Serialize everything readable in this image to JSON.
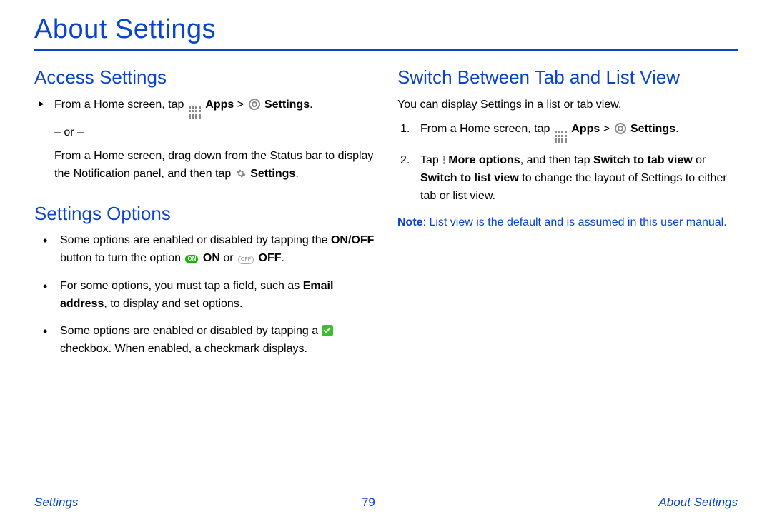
{
  "title": "About Settings",
  "footer": {
    "left": "Settings",
    "page": "79",
    "right": "About Settings"
  },
  "left": {
    "access_heading": "Access Settings",
    "access": {
      "line1_a": "From a Home screen, tap ",
      "apps_bold": "Apps",
      "gt": " > ",
      "settings_bold": "Settings",
      "period": ".",
      "or": "– or –",
      "line2_a": "From a Home screen, drag down from the Status bar to display the Notification panel, and then tap ",
      "line2_settings_bold": "Settings",
      "line2_end": "."
    },
    "options_heading": "Settings Options",
    "options": {
      "b1_a": "Some options are enabled or disabled by tapping the ",
      "b1_onoff": "ON/OFF",
      "b1_b": " button to turn the option ",
      "b1_on_label": "ON",
      "b1_on_bold": "ON",
      "b1_or": " or ",
      "b1_off_label": "OFF",
      "b1_off_bold": "OFF",
      "b1_end": ".",
      "b2_a": "For some options, you must tap a field, such as ",
      "b2_email": "Email address",
      "b2_b": ", to display and set options.",
      "b3_a": "Some options are enabled or disabled by tapping a ",
      "b3_b": " checkbox. When enabled, a checkmark displays."
    }
  },
  "right": {
    "switch_heading": "Switch Between Tab and List View",
    "intro": "You can display Settings in a list or tab view.",
    "step1_a": "From a Home screen, tap ",
    "step1_apps": "Apps",
    "step1_gt": " > ",
    "step1_settings": "Settings",
    "step1_end": ".",
    "step2_a": "Tap ",
    "step2_more": "More options",
    "step2_b": ", and then tap ",
    "step2_tab": "Switch to tab view",
    "step2_or": " or ",
    "step2_list": "Switch to list view",
    "step2_c": " to change the layout of Settings to either tab or list view.",
    "note_label": "Note",
    "note_text": ": List view is the default and is assumed in this user manual."
  }
}
